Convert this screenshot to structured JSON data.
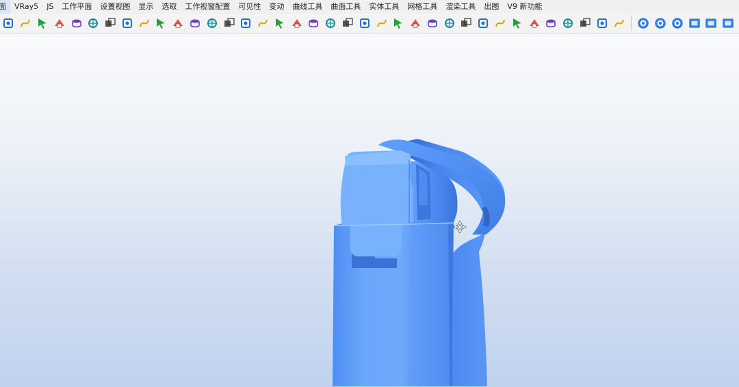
{
  "menubar": {
    "items": [
      "面",
      "VRay5",
      "JS",
      "工作平面",
      "设置视图",
      "显示",
      "选取",
      "工作视窗配置",
      "可见性",
      "变动",
      "曲线工具",
      "曲面工具",
      "实体工具",
      "网格工具",
      "渲染工具",
      "出图",
      "V9 新功能"
    ]
  },
  "toolbar": {
    "icons": [
      "arrow-icon",
      "curve-brush-icon",
      "lasso-select-icon",
      "checker-icon",
      "window-select-icon",
      "select-points-icon",
      "select-curves-icon",
      "select-objects-icon",
      "target-icon",
      "gumball-icon",
      "cylinder-icon",
      "surface-patch-icon",
      "loft-icon",
      "extrude-icon",
      "box-icon",
      "lock-icon",
      "move-icon",
      "viewport-icon",
      "rotate-icon",
      "scale-icon",
      "layer-icon",
      "material-icon",
      "render-icon",
      "spline-icon",
      "point-cloud-icon",
      "pencil-icon",
      "sphere-icon",
      "text-icon",
      "fill-icon",
      "chain-icon",
      "spiral-icon",
      "diamond-icon",
      "cube-icon",
      "polyline-icon",
      "arc-icon",
      "tool-icon",
      "solid-box-icon"
    ],
    "right_icons": [
      "view-top-icon",
      "view-front-icon",
      "view-right-icon",
      "plane-icon",
      "shade-icon",
      "frame-icon",
      "render-view-icon",
      "maximize-view-icon"
    ]
  },
  "colors": {
    "model_blue": "#6fa8f8",
    "accent": "#2f7fe3",
    "menubar_bg": "#f0f0f0"
  }
}
